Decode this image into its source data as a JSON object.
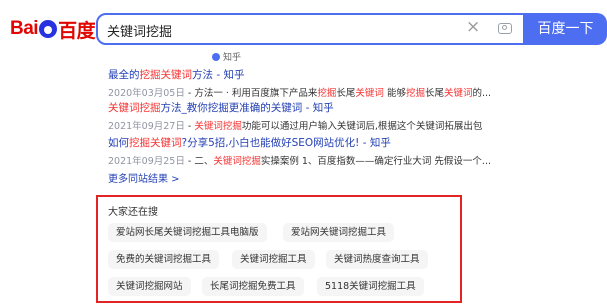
{
  "header": {
    "logo_part1": "Bai",
    "logo_part2": "百度",
    "search_query": "关键词挖掘",
    "clear_icon": "close-icon",
    "camera_icon": "camera-icon",
    "search_button": "百度一下"
  },
  "partial_source": "知乎",
  "results": [
    {
      "title_parts": [
        {
          "t": "最全的",
          "h": false
        },
        {
          "t": "挖掘关键词",
          "h": true
        },
        {
          "t": "方法 - 知乎",
          "h": false
        }
      ],
      "date": "2020年03月05日",
      "desc_parts": [
        {
          "t": " - 方法一 · 利用百度旗下产品来",
          "h": false
        },
        {
          "t": "挖掘",
          "h": true
        },
        {
          "t": "长尾",
          "h": false
        },
        {
          "t": "关键词",
          "h": true
        },
        {
          "t": " 能够",
          "h": false
        },
        {
          "t": "挖掘",
          "h": true
        },
        {
          "t": "长尾",
          "h": false
        },
        {
          "t": "关键词",
          "h": true
        },
        {
          "t": "的...",
          "h": false
        }
      ]
    },
    {
      "title_parts": [
        {
          "t": "关键词挖掘",
          "h": true
        },
        {
          "t": "方法_教你挖掘更准确的关键词 - 知乎",
          "h": false
        }
      ],
      "date": "2021年09月27日",
      "desc_parts": [
        {
          "t": " - ",
          "h": false
        },
        {
          "t": "关键词挖掘",
          "h": true
        },
        {
          "t": "功能可以通过用户输入关键词后,根据这个关键词拓展出包",
          "h": false
        }
      ]
    },
    {
      "title_parts": [
        {
          "t": "如何",
          "h": false
        },
        {
          "t": "挖掘关键词",
          "h": true
        },
        {
          "t": "?分享5招,小白也能做好SEO网站优化! - 知乎",
          "h": false
        }
      ],
      "date": "2021年09月25日",
      "desc_parts": [
        {
          "t": " - 二、",
          "h": false
        },
        {
          "t": "关键词挖掘",
          "h": true
        },
        {
          "t": "实操案例 1、百度指数——确定行业大词 先假设一个...",
          "h": false
        }
      ]
    }
  ],
  "more_link": "更多同站结果 >",
  "related": {
    "heading": "大家还在搜",
    "chips": [
      "爱站网长尾关键词挖掘工具电脑版",
      "爱站网关键词挖掘工具",
      "免费的关键词挖掘工具",
      "关键词挖掘工具",
      "关键词热度查询工具",
      "关键词挖掘网站",
      "长尾词挖掘免费工具",
      "5118关键词挖掘工具"
    ]
  }
}
